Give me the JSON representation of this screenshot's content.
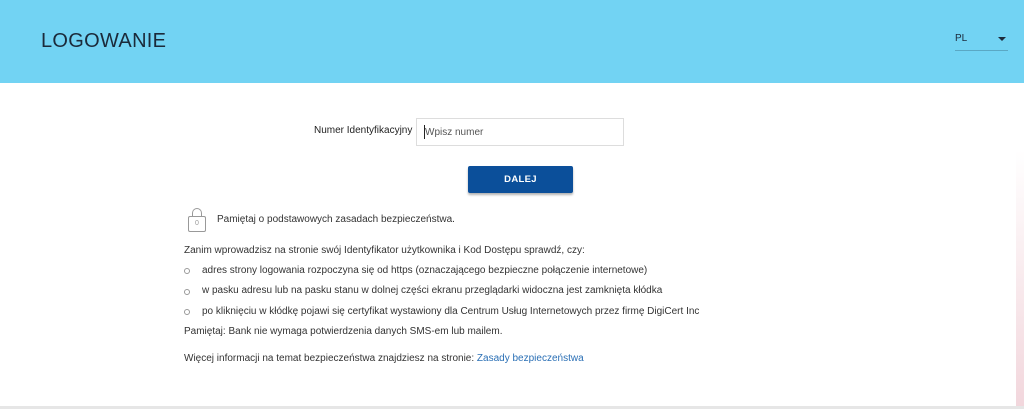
{
  "header": {
    "title": "LOGOWANIE",
    "language": "PL",
    "accent_color": "#72d3f3"
  },
  "login_form": {
    "id_label": "Numer Identyfikacyjny",
    "id_placeholder": "Wpisz numer",
    "id_value": "",
    "next_button": "DALEJ",
    "button_color": "#0b4f9a"
  },
  "security": {
    "lock_icon": "lock-icon",
    "reminder": "Pamiętaj o podstawowych zasadach bezpieczeństwa.",
    "intro": "Zanim wprowadzisz na stronie swój Identyfikator użytkownika i Kod Dostępu sprawdź, czy:",
    "items": [
      "adres strony logowania rozpoczyna się od https (oznaczającego bezpieczne połączenie internetowe)",
      "w pasku adresu lub na pasku stanu w dolnej części ekranu przeglądarki widoczna jest zamknięta kłódka",
      "po kliknięciu w kłódkę pojawi się certyfikat wystawiony dla Centrum Usług Internetowych przez firmę DigiCert Inc"
    ],
    "sms_note": "Pamiętaj: Bank nie wymaga potwierdzenia danych SMS-em lub mailem.",
    "more_info_text": "Więcej informacji na temat bezpieczeństwa znajdziesz na stronie:",
    "more_info_link": "Zasady bezpieczeństwa"
  }
}
